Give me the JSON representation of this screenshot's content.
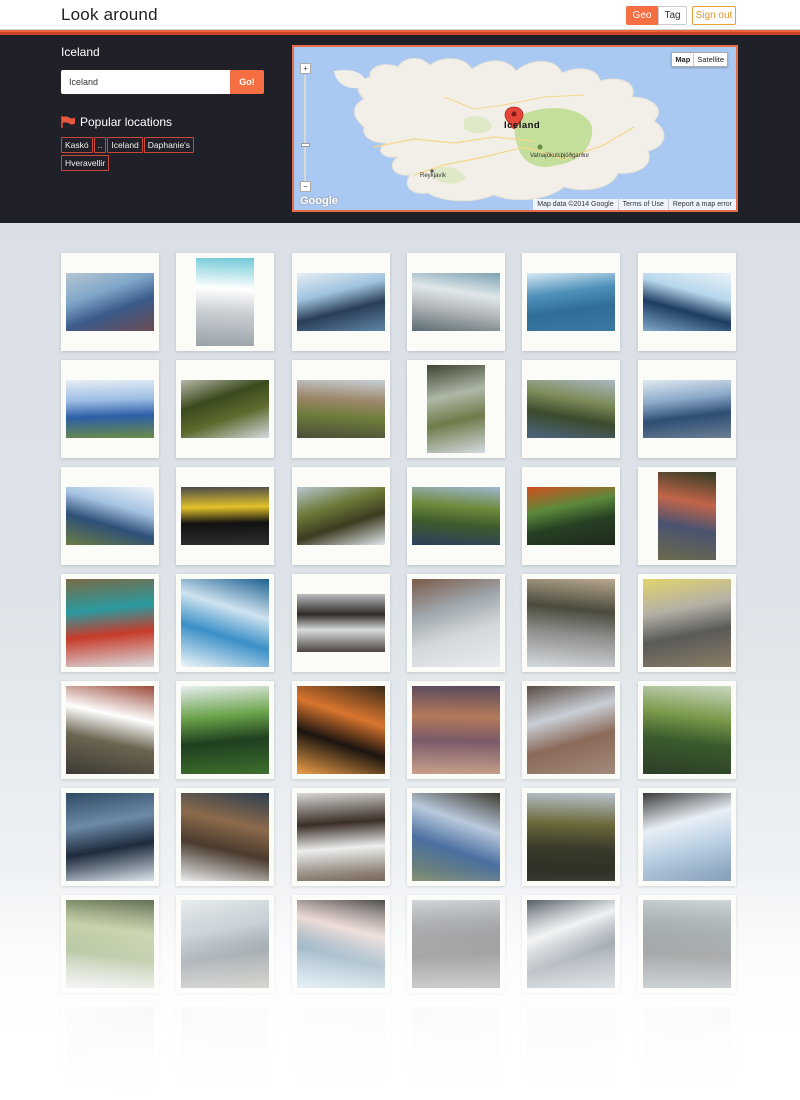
{
  "header": {
    "title": "Look around",
    "geo_label": "Geo",
    "tag_label": "Tag",
    "signout_label": "Sign out"
  },
  "search": {
    "location_title": "Iceland",
    "query_value": "Iceland",
    "go_label": "Go!"
  },
  "popular": {
    "heading": "Popular locations",
    "icon": "flag-icon",
    "locations": [
      "Kaskó",
      "..",
      "Iceland",
      "Daphanie's",
      "Hveravellir"
    ]
  },
  "map": {
    "view_map_label": "Map",
    "view_satellite_label": "Satellite",
    "active_view": "Map",
    "marker_label": "Iceland",
    "labels": [
      "Reykjavík",
      "Vatnajökulsþjóðgarður"
    ],
    "provider": "Google",
    "attribution": [
      "Map data ©2014 Google",
      "Terms of Use",
      "Report a map error"
    ],
    "zoom_in": "+",
    "zoom_out": "−",
    "colors": {
      "sea": "#a9c8f2",
      "land": "#f2efe8",
      "park": "#c4df9b",
      "marker": "#e5463a"
    }
  },
  "photos": {
    "rows": 8,
    "columns": 6,
    "palettes": [
      [
        "#3b5a8a",
        "#7fa7c9",
        "#b7c6d2",
        "#6b4b52"
      ],
      [
        "#c9ced2",
        "#ffffff",
        "#6fc9d6",
        "#9aa2a8"
      ],
      [
        "#2a3e56",
        "#9fc3de",
        "#e6eef4",
        "#5f86a8"
      ],
      [
        "#b3b6b8",
        "#dfe7ea",
        "#7da1b0",
        "#5a6b73"
      ],
      [
        "#2f6e96",
        "#4d90b9",
        "#d8eaf4",
        "#3a7aa3"
      ],
      [
        "#1d3c62",
        "#b7d7ec",
        "#e9f2f7",
        "#7fa8c7"
      ],
      [
        "#2c5fa8",
        "#9dbde4",
        "#e6eef6",
        "#6c8c46"
      ],
      [
        "#5d6b2e",
        "#3b4a1d",
        "#b5b7a7",
        "#d6dbe1"
      ],
      [
        "#6e7d3b",
        "#9d876a",
        "#c7cfd7",
        "#4a4e3a"
      ],
      [
        "#6f7b4a",
        "#aeb8a6",
        "#3d4430",
        "#d4dbe0"
      ],
      [
        "#3b4b2c",
        "#7e8c5a",
        "#aab8c3",
        "#4d6582"
      ],
      [
        "#2d4e74",
        "#8aa8c8",
        "#e1eaf2",
        "#6d7f94"
      ],
      [
        "#2e4f78",
        "#a5c3e2",
        "#eef4f9",
        "#6b7d44"
      ],
      [
        "#111111",
        "#e2c22a",
        "#4a4a4a",
        "#2e2e2e"
      ],
      [
        "#3d3b20",
        "#6d7a39",
        "#b8c7d2",
        "#e2e9ee"
      ],
      [
        "#3e5b2c",
        "#6e8a3c",
        "#9eb7d0",
        "#2d3f5f"
      ],
      [
        "#264023",
        "#5c8a3b",
        "#d24f1e",
        "#1e2a1c"
      ],
      [
        "#4a5370",
        "#c2654a",
        "#2f3a22",
        "#6b6a4d"
      ],
      [
        "#c73b2a",
        "#2a9aa0",
        "#7a6a46",
        "#d9dde0"
      ],
      [
        "#3a8fc7",
        "#cfe3f0",
        "#1d5f90",
        "#f1f6f9"
      ],
      [
        "#d9dcdd",
        "#2f2b28",
        "#b9bcbe",
        "#4a4541"
      ],
      [
        "#d3d8da",
        "#a0a8ae",
        "#7a5a4a",
        "#e9ecee"
      ],
      [
        "#8f8f8e",
        "#4a4a3c",
        "#b9a88f",
        "#d6dbdf"
      ],
      [
        "#5a5a58",
        "#b4b0a6",
        "#e1d46c",
        "#8a7c66"
      ],
      [
        "#6b6450",
        "#ffffff",
        "#9a4b3c",
        "#3c3a35"
      ],
      [
        "#1f3f20",
        "#6aa34a",
        "#e8eef0",
        "#3d6f2c"
      ],
      [
        "#1b140f",
        "#d9752e",
        "#3a2a18",
        "#f0a048"
      ],
      [
        "#7a5a6a",
        "#b47a5a",
        "#5a4a5e",
        "#c8a08a"
      ],
      [
        "#8b6a5a",
        "#c9cfd6",
        "#5a4a42",
        "#a28a7a"
      ],
      [
        "#3a5a2c",
        "#7a9a4c",
        "#c9d8c0",
        "#2b3f28"
      ],
      [
        "#1d2b3c",
        "#6d8aa8",
        "#2e4a63",
        "#d7e2ea"
      ],
      [
        "#4a3b2e",
        "#8c6a4b",
        "#2c3e50",
        "#e8eaeb"
      ],
      [
        "#eceeee",
        "#3b2e26",
        "#d8d8d6",
        "#6b5a4a"
      ],
      [
        "#4a6fa0",
        "#b9c9dc",
        "#3d3a30",
        "#7d8a6a"
      ],
      [
        "#3a3a2a",
        "#6d6a3c",
        "#b7c4cf",
        "#2a2a24"
      ],
      [
        "#b9cfe2",
        "#e8eff6",
        "#3a3a3a",
        "#7f98b4"
      ],
      [
        "#6b8a3c",
        "#a5b87a",
        "#3b4a2a",
        "#d8dde0"
      ],
      [
        "#3e4f5c",
        "#a8b6bf",
        "#e3e8ea",
        "#6d6a5a"
      ],
      [
        "#3e6e8e",
        "#e4c9c2",
        "#1f1f1f",
        "#9fc8de"
      ],
      [
        "#2a2e33",
        "#6a6e72",
        "#c9cdd1",
        "#454a4f"
      ],
      [
        "#4a5a6a",
        "#e8ecef",
        "#2a3440",
        "#8a98a6"
      ],
      [
        "#353b3f",
        "#6d7a7f",
        "#c4ccd1",
        "#4a5a62"
      ],
      [
        "#dfe2e4",
        "#c8ced1",
        "#eef0f1",
        "#d4d9dc"
      ],
      [
        "#e2e5e6",
        "#cfd6da",
        "#f0f2f3",
        "#d8dde0"
      ],
      [
        "#e8ecef",
        "#dfe3e6",
        "#f2f4f5",
        "#d9dee1"
      ],
      [
        "#e5e8ea",
        "#d6dce0",
        "#eff1f3",
        "#dde1e4"
      ],
      [
        "#e1e4e6",
        "#d2d8dc",
        "#eef0f2",
        "#d9dde0"
      ],
      [
        "#e4e7e9",
        "#d8dde1",
        "#f0f2f3",
        "#dfe3e6"
      ]
    ]
  }
}
